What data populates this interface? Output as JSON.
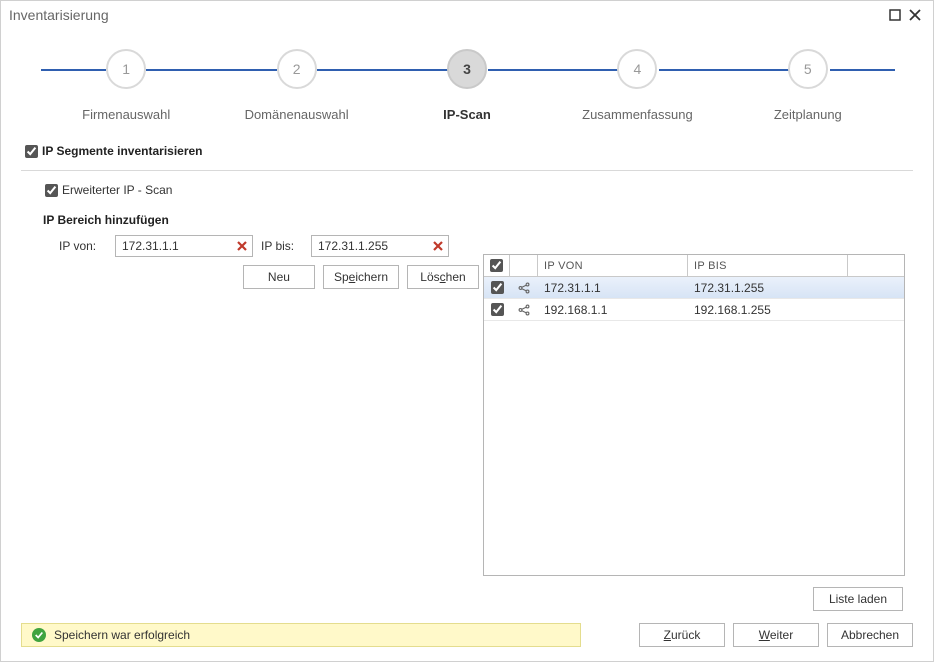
{
  "window": {
    "title": "Inventarisierung"
  },
  "stepper": {
    "steps": [
      {
        "num": "1",
        "label": "Firmenauswahl"
      },
      {
        "num": "2",
        "label": "Domänenauswahl"
      },
      {
        "num": "3",
        "label": "IP-Scan"
      },
      {
        "num": "4",
        "label": "Zusammenfassung"
      },
      {
        "num": "5",
        "label": "Zeitplanung"
      }
    ],
    "active_index": 2
  },
  "checks": {
    "segments_label": "IP Segmente inventarisieren",
    "segments_checked": true,
    "extended_label": "Erweiterter IP - Scan",
    "extended_checked": true
  },
  "section": {
    "add_range_header": "IP Bereich hinzufügen"
  },
  "form": {
    "from_label": "IP von:",
    "to_label": "IP bis:",
    "from_value": "172.31.1.1",
    "to_value": "172.31.1.255",
    "btn_new": "Neu",
    "btn_save_pre": "Sp",
    "btn_save_u": "e",
    "btn_save_post": "ichern",
    "btn_delete_pre": "Lös",
    "btn_delete_u": "c",
    "btn_delete_post": "hen"
  },
  "table": {
    "header_from": "IP VON",
    "header_to": "IP BIS",
    "rows": [
      {
        "checked": true,
        "from": "172.31.1.1",
        "to": "172.31.1.255",
        "selected": true
      },
      {
        "checked": true,
        "from": "192.168.1.1",
        "to": "192.168.1.255",
        "selected": false
      }
    ],
    "select_all_checked": true
  },
  "buttons": {
    "load_list": "Liste laden",
    "back_pre": "",
    "back_u": "Z",
    "back_post": "urück",
    "next_pre": "",
    "next_u": "W",
    "next_post": "eiter",
    "cancel": "Abbrechen"
  },
  "status": {
    "text": "Speichern war erfolgreich"
  }
}
